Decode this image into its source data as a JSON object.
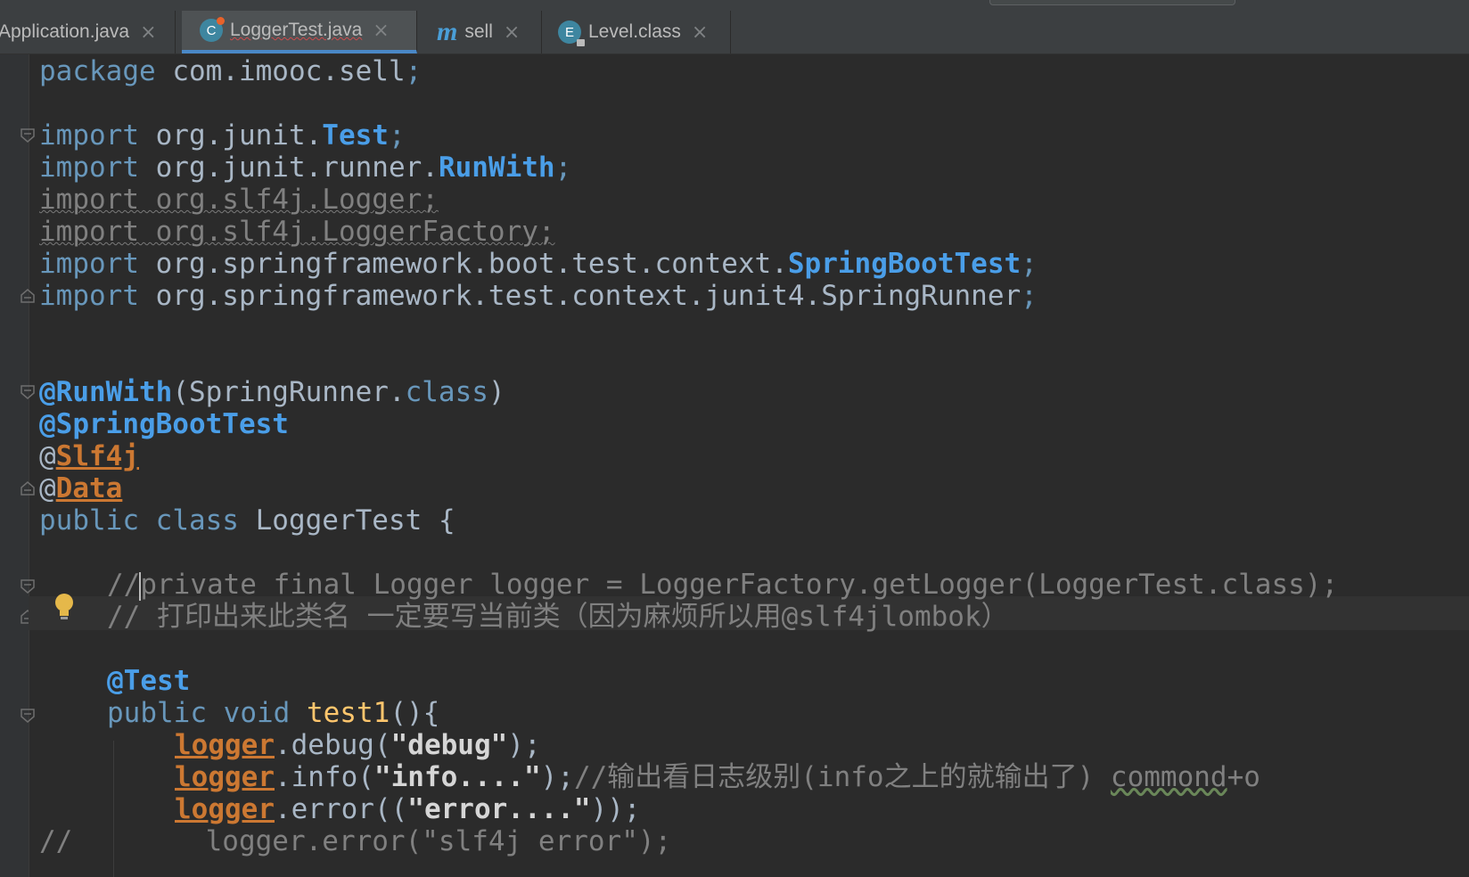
{
  "tabs": [
    {
      "label": "Application.java",
      "icon": "java-class-icon"
    },
    {
      "label": "LoggerTest.java",
      "icon": "java-class-icon",
      "active": true
    },
    {
      "label": "sell",
      "icon": "maven-module-icon"
    },
    {
      "label": "Level.class",
      "icon": "enum-class-icon"
    }
  ],
  "close_glyph": "×",
  "editor": {
    "l1_kw": "package",
    "l1_rest": " com.imooc.sell",
    "l3_kw": "import",
    "l3_pkg": " org.junit.",
    "l3_cls": "Test",
    "l4_kw": "import",
    "l4_pkg": " org.junit.runner.",
    "l4_cls": "RunWith",
    "l5": "import org.slf4j.Logger;",
    "l6": "import org.slf4j.LoggerFactory;",
    "l7_kw": "import",
    "l7_pkg": " org.springframework.boot.test.context.",
    "l7_cls": "SpringBootTest",
    "l8_kw": "import",
    "l8_pkg": " org.springframework.test.context.junit4.SpringRunner",
    "semicolon": ";",
    "l11_ann": "@RunWith",
    "l11_open": "(SpringRunner.",
    "l11_class": "class",
    "l11_close": ")",
    "l12_ann": "@SpringBootTest",
    "at": "@",
    "l13_name": "Slf4j",
    "l14_name": "Data",
    "l15_kw1": "public",
    "l15_kw2": "class",
    "l15_rest": " LoggerTest {",
    "l17_slashes": "//",
    "l17_rest": "private final Logger logger = LoggerFactory.getLogger(LoggerTest.class);",
    "l18": "// 打印出来此类名 一定要写当前类（因为麻烦所以用@slf4jlombok）",
    "l20_ann": "@Test",
    "l21_kw1": "public",
    "l21_kw2": "void",
    "l21_method": "test1",
    "l21_rest": "(){",
    "logger": "logger",
    "l22_call": ".debug(",
    "l22_str": "\"debug\"",
    "l22_end": ");",
    "l23_call": ".info(",
    "l23_str": "\"info....\"",
    "l23_end": ");",
    "l23_cmt": "//输出看日志级别(info之上的就输出了) ",
    "l23_word": "commond",
    "l23_tail": "+o",
    "l24_call": ".error((",
    "l24_str": "\"error....\"",
    "l24_end": "));",
    "l25_partial": "//        logger.error(\"slf4j error\");"
  }
}
